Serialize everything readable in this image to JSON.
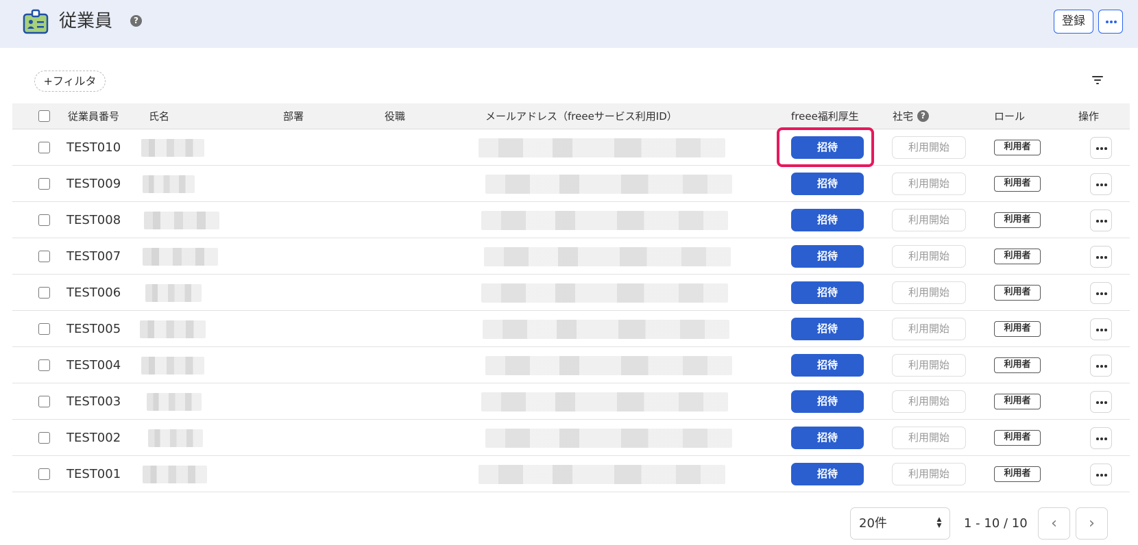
{
  "header": {
    "title": "従業員",
    "help_glyph": "?",
    "register_label": "登録",
    "app_icon": "employee-id-card-icon",
    "background": "#e9eef8"
  },
  "toolbar": {
    "filter_label": "+フィルタ"
  },
  "table": {
    "columns": {
      "employee_no": "従業員番号",
      "name": "氏名",
      "department": "部署",
      "position": "役職",
      "email": "メールアドレス（freeeサービス利用ID）",
      "welfare": "freee福利厚生",
      "housing": "社宅",
      "role": "ロール",
      "actions": "操作"
    },
    "rows": [
      {
        "id": "TEST010",
        "invite": "招待",
        "start": "利用開始",
        "role": "利用者"
      },
      {
        "id": "TEST009",
        "invite": "招待",
        "start": "利用開始",
        "role": "利用者"
      },
      {
        "id": "TEST008",
        "invite": "招待",
        "start": "利用開始",
        "role": "利用者"
      },
      {
        "id": "TEST007",
        "invite": "招待",
        "start": "利用開始",
        "role": "利用者"
      },
      {
        "id": "TEST006",
        "invite": "招待",
        "start": "利用開始",
        "role": "利用者"
      },
      {
        "id": "TEST005",
        "invite": "招待",
        "start": "利用開始",
        "role": "利用者"
      },
      {
        "id": "TEST004",
        "invite": "招待",
        "start": "利用開始",
        "role": "利用者"
      },
      {
        "id": "TEST003",
        "invite": "招待",
        "start": "利用開始",
        "role": "利用者"
      },
      {
        "id": "TEST002",
        "invite": "招待",
        "start": "利用開始",
        "role": "利用者"
      },
      {
        "id": "TEST001",
        "invite": "招待",
        "start": "利用開始",
        "role": "利用者"
      }
    ]
  },
  "pagination": {
    "page_size": "20件",
    "range": "1 - 10 / 10",
    "prev_glyph": "‹",
    "next_glyph": "›"
  },
  "colors": {
    "accent": "#2b5fd0",
    "highlight": "#e6195c"
  }
}
